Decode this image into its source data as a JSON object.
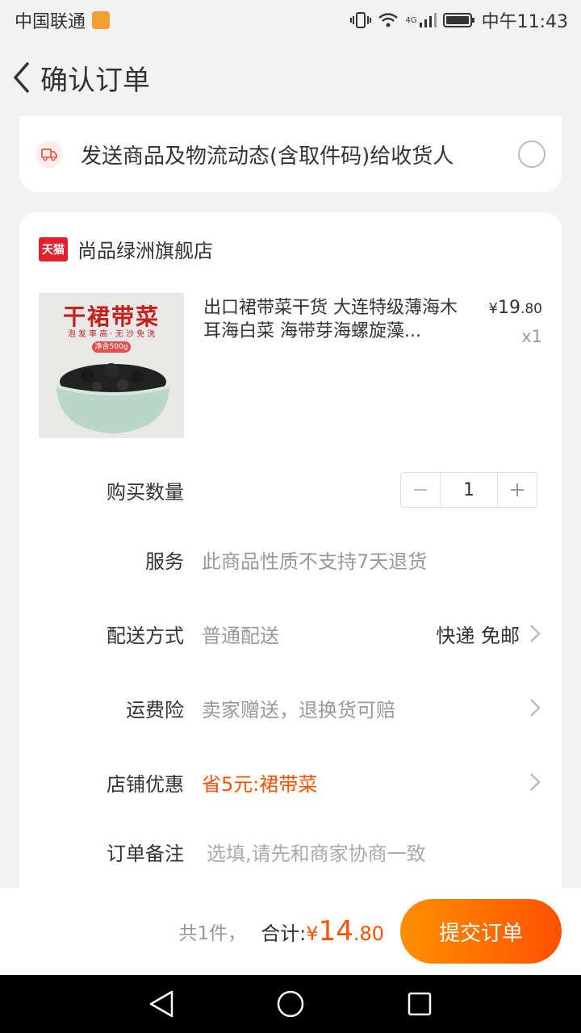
{
  "status_bar": {
    "carrier": "中国联通",
    "network": "4G",
    "time": "中午11:43"
  },
  "header": {
    "title": "确认订单"
  },
  "notify": {
    "text": "发送商品及物流动态(含取件码)给收货人",
    "checked": false
  },
  "store": {
    "badge": "天猫",
    "name": "尚品绿洲旗舰店"
  },
  "product": {
    "title": "出口裙带菜干货 大连特级薄海木耳海白菜 海带芽海螺旋藻...",
    "price_currency": "¥",
    "price_int": "19",
    "price_dec": ".80",
    "quantity_text": "x1",
    "image": {
      "title": "干裙带菜",
      "subtitle": "泡 发 率 高 · 无 沙 免 洗",
      "weight": "净含500g"
    }
  },
  "order_rows": {
    "quantity_label": "购买数量",
    "quantity_value": "1",
    "service_label": "服务",
    "service_value": "此商品性质不支持7天退货",
    "delivery_label": "配送方式",
    "delivery_value": "普通配送",
    "delivery_right": "快递 免邮",
    "insurance_label": "运费险",
    "insurance_value": "卖家赠送，退换货可赔",
    "discount_label": "店铺优惠",
    "discount_value": "省5元:裙带菜",
    "remark_label": "订单备注",
    "remark_placeholder": "选填,请先和商家协商一致"
  },
  "footer": {
    "count_text": "共1件，",
    "total_label": "合计:",
    "total_currency": "¥",
    "total_int": "14",
    "total_dec": ".80",
    "submit_label": "提交订单"
  },
  "colors": {
    "accent": "#ff5000",
    "brand_red": "#e5202e"
  }
}
